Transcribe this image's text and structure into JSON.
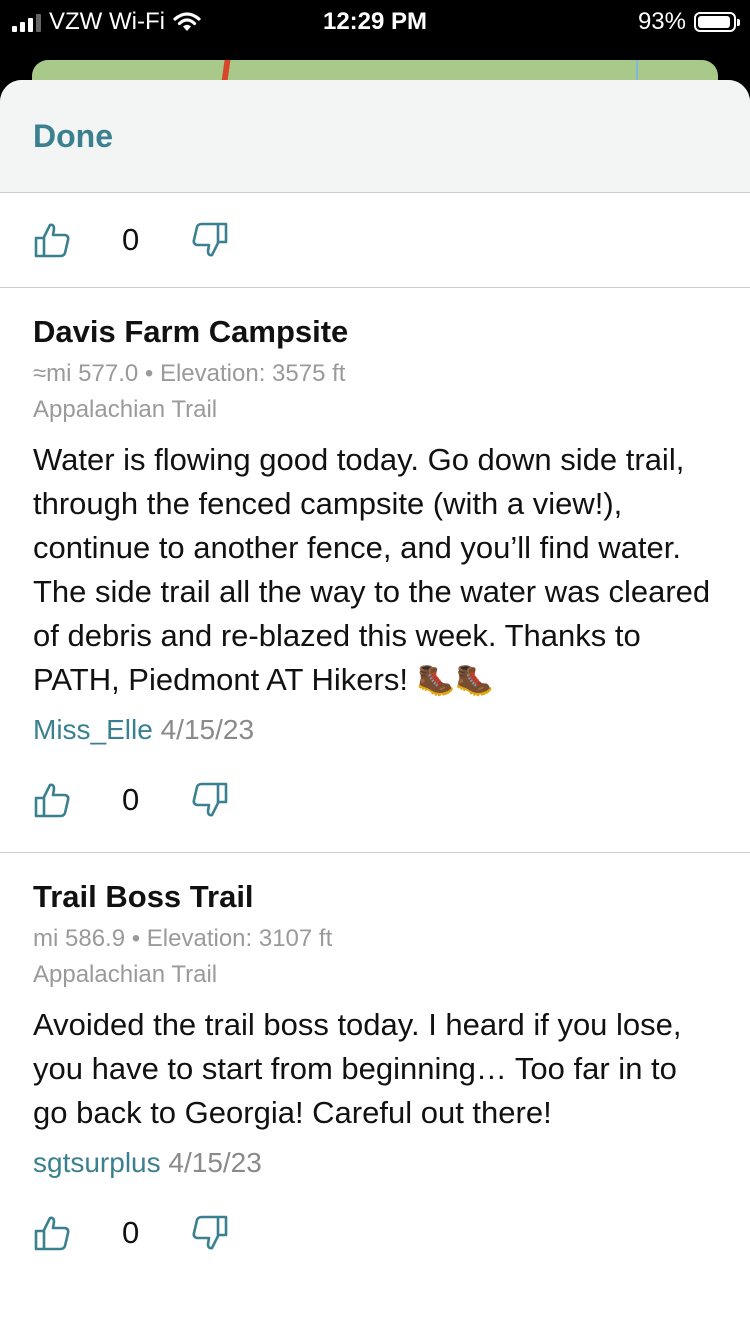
{
  "status_bar": {
    "carrier": "VZW Wi-Fi",
    "time": "12:29 PM",
    "battery_pct": "93%",
    "battery_level": 0.93
  },
  "header": {
    "done_label": "Done"
  },
  "top_votes": {
    "count": "0"
  },
  "comments": [
    {
      "title": "Davis Farm Campsite",
      "meta": "≈mi 577.0 • Elevation: 3575 ft",
      "trail": "Appalachian Trail",
      "body": "Water is flowing good today. Go down side trail, through the fenced campsite (with a view!), continue to another fence, and you’ll find water. The side trail all the way to the water was cleared of debris and re-blazed this week. Thanks to PATH, Piedmont AT Hikers!",
      "emoji": "🥾🥾",
      "author": "Miss_Elle",
      "date": "4/15/23",
      "votes": "0"
    },
    {
      "title": "Trail Boss Trail",
      "meta": "mi 586.9 • Elevation: 3107 ft",
      "trail": "Appalachian Trail",
      "body": "Avoided the trail boss today. I heard if you lose, you have to start from beginning… Too far in to go back to Georgia! Careful out there!",
      "author": "sgtsurplus",
      "date": "4/15/23",
      "votes": "0"
    }
  ],
  "colors": {
    "accent": "#3a8090",
    "secondary_text": "#9a9a9a"
  },
  "icons": {
    "upvote": "thumbs-up-icon",
    "downvote": "thumbs-down-icon",
    "boot": "hiking-boot-icon"
  }
}
